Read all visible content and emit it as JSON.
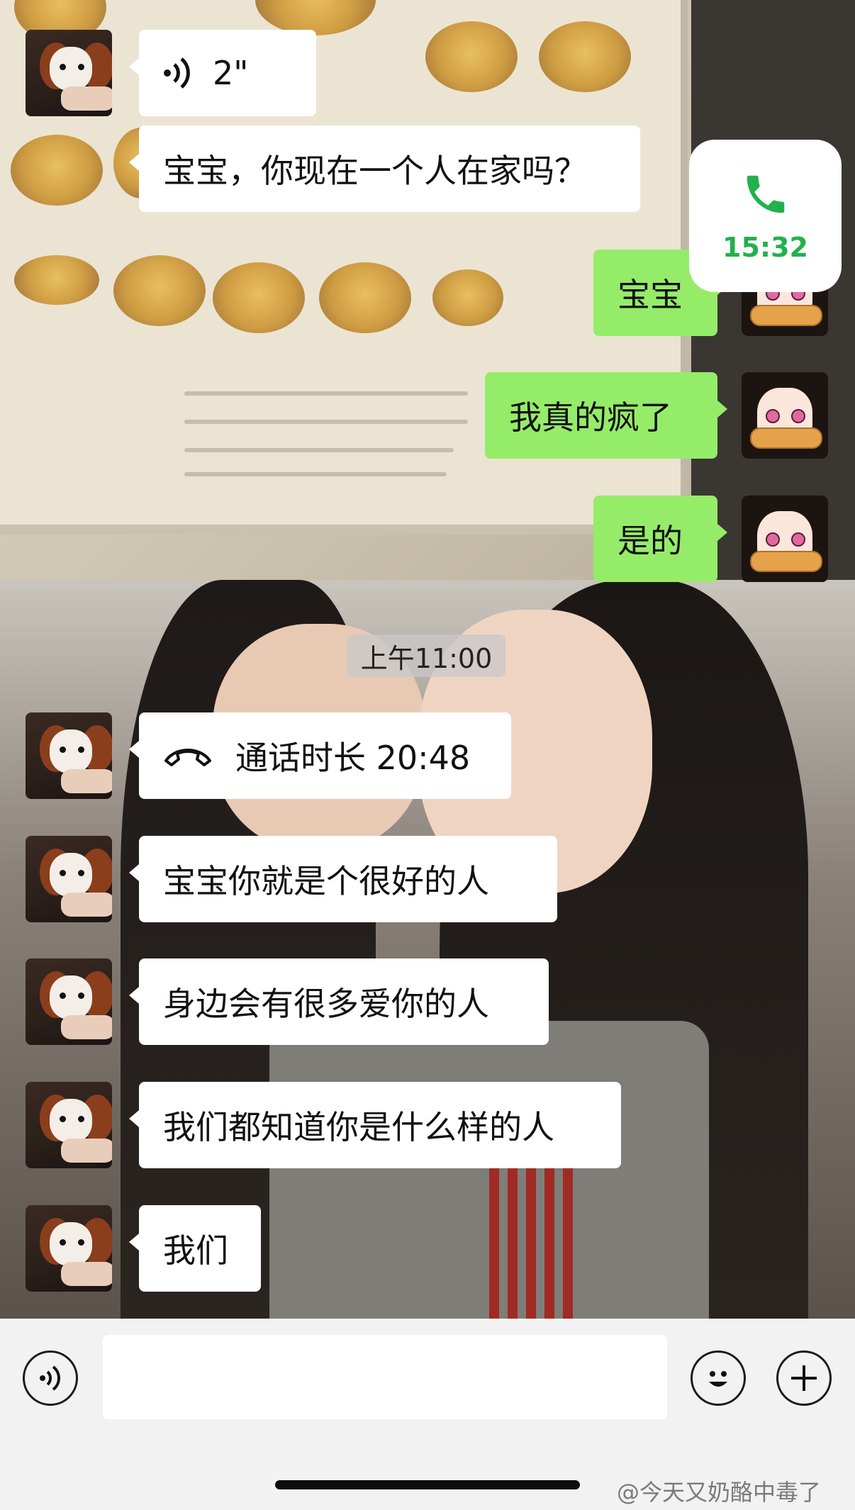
{
  "call_badge": {
    "time": "15:32",
    "icon": "phone-icon"
  },
  "messages_top": [
    {
      "side": "left",
      "type": "voice",
      "duration": "2\"",
      "icon": "voice-wave-icon"
    },
    {
      "side": "left",
      "text": "宝宝，你现在一个人在家吗？"
    },
    {
      "side": "right",
      "text": "宝宝"
    },
    {
      "side": "right",
      "text": "我真的疯了"
    },
    {
      "side": "right",
      "text": "是的"
    }
  ],
  "timestamp": "上午11:00",
  "messages_bottom": [
    {
      "side": "left",
      "type": "call",
      "text": "通话时长 20:48",
      "icon": "hang-up-icon"
    },
    {
      "side": "left",
      "text": "宝宝你就是个很好的人"
    },
    {
      "side": "left",
      "text": "身边会有很多爱你的人"
    },
    {
      "side": "left",
      "text": "我们都知道你是什么样的人"
    },
    {
      "side": "left",
      "text": "我们"
    }
  ],
  "input_bar": {
    "voice_button_icon": "voice-input-icon",
    "text_value": "",
    "emoji_button_icon": "emoji-icon",
    "plus_button_icon": "plus-icon"
  },
  "watermark": "@今天又奶酪中毒了",
  "colors": {
    "self_bubble": "#95ec69",
    "other_bubble": "#ffffff",
    "call_green": "#22b14c"
  }
}
